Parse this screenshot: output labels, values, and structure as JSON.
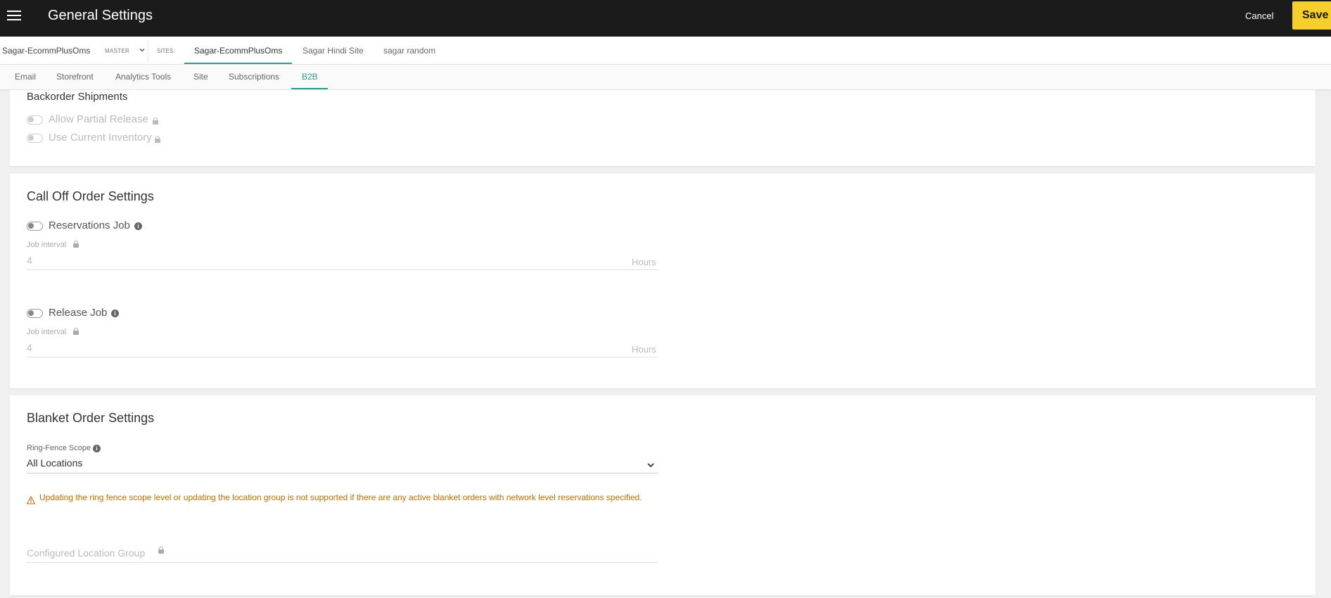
{
  "header": {
    "title": "General Settings",
    "cancel_label": "Cancel",
    "save_label": "Save"
  },
  "sitebar": {
    "tenant": "Sagar-EcommPlusOms",
    "master_badge": "MASTER",
    "sites_label": "SITES:",
    "sites": [
      {
        "label": "Sagar-EcommPlusOms",
        "active": true
      },
      {
        "label": "Sagar Hindi Site",
        "active": false
      },
      {
        "label": "sagar random",
        "active": false
      }
    ]
  },
  "tabs": [
    {
      "label": "Email",
      "active": false
    },
    {
      "label": "Storefront",
      "active": false
    },
    {
      "label": "Analytics Tools",
      "active": false
    },
    {
      "label": "Site",
      "active": false
    },
    {
      "label": "Subscriptions",
      "active": false
    },
    {
      "label": "B2B",
      "active": true
    }
  ],
  "backorder": {
    "title": "Backorder Shipments",
    "allow_partial_release": "Allow Partial Release",
    "use_current_inventory": "Use Current Inventory"
  },
  "call_off": {
    "title": "Call Off Order Settings",
    "reservations_job": {
      "label": "Reservations Job",
      "interval_label": "Job interval",
      "interval_value": "4",
      "interval_unit": "Hours"
    },
    "release_job": {
      "label": "Release Job",
      "interval_label": "Job interval",
      "interval_value": "4",
      "interval_unit": "Hours"
    }
  },
  "blanket": {
    "title": "Blanket Order Settings",
    "ring_fence_label": "Ring-Fence Scope",
    "ring_fence_value": "All Locations",
    "warning": "Updating the ring fence scope level or updating the location group is not supported if there are any active blanket orders with network level reservations specified.",
    "configured_location_group": "Configured Location Group"
  },
  "colors": {
    "topbar": "#1b1b1b",
    "save_button": "#f6cf2d",
    "accent": "#2a9d8f",
    "warning": "#b76e00"
  }
}
